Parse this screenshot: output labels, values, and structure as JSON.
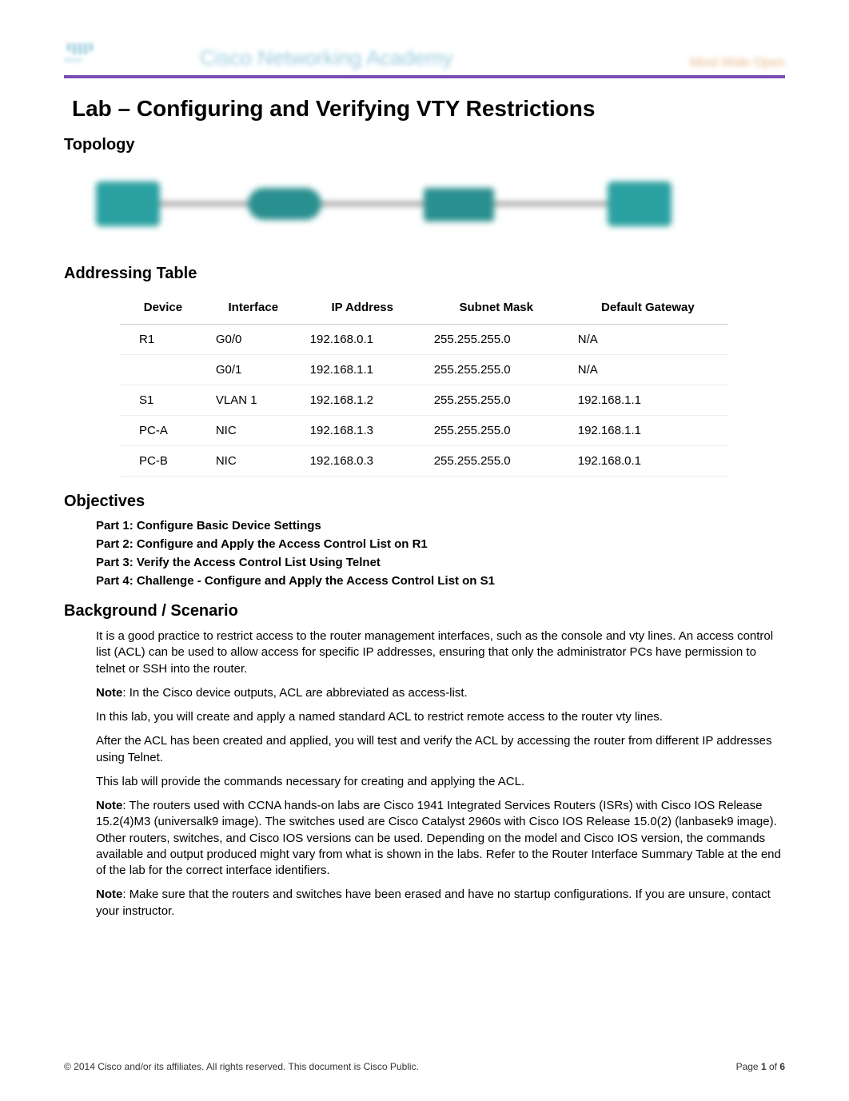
{
  "header": {
    "logo_word": "cisco",
    "academy": "Cisco Networking Academy",
    "tagline": "Mind Wide Open"
  },
  "title": "Lab – Configuring and Verifying VTY Restrictions",
  "sections": {
    "topology": "Topology",
    "addressing": "Addressing Table",
    "objectives": "Objectives",
    "background": "Background / Scenario"
  },
  "addressing_table": {
    "headers": [
      "Device",
      "Interface",
      "IP Address",
      "Subnet Mask",
      "Default Gateway"
    ],
    "rows": [
      [
        "R1",
        "G0/0",
        "192.168.0.1",
        "255.255.255.0",
        "N/A"
      ],
      [
        "",
        "G0/1",
        "192.168.1.1",
        "255.255.255.0",
        "N/A"
      ],
      [
        "S1",
        "VLAN 1",
        "192.168.1.2",
        "255.255.255.0",
        "192.168.1.1"
      ],
      [
        "PC-A",
        "NIC",
        "192.168.1.3",
        "255.255.255.0",
        "192.168.1.1"
      ],
      [
        "PC-B",
        "NIC",
        "192.168.0.3",
        "255.255.255.0",
        "192.168.0.1"
      ]
    ]
  },
  "objectives": [
    "Part 1: Configure Basic Device Settings",
    "Part 2: Configure and Apply the Access Control List on R1",
    "Part 3: Verify the Access Control List Using Telnet",
    "Part 4: Challenge - Configure and Apply the Access Control List on S1"
  ],
  "background_paras": [
    "It is a good practice to restrict access to the router management interfaces, such as the console and vty lines. An access control list (ACL) can be used to allow access for specific IP addresses, ensuring that only the administrator PCs have permission to telnet or SSH into the router.",
    "Note: In the Cisco device outputs, ACL are abbreviated as access-list.",
    "In this lab, you will create and apply a named standard ACL to restrict remote access to the router vty lines.",
    "After the ACL has been created and applied, you will test and verify the ACL by accessing the router from different IP addresses using Telnet.",
    "This lab will provide the commands necessary for creating and applying the ACL.",
    "Note: The routers used with CCNA hands-on labs are Cisco 1941 Integrated Services Routers (ISRs) with Cisco IOS Release 15.2(4)M3 (universalk9 image). The switches used are Cisco Catalyst 2960s with Cisco IOS Release 15.0(2) (lanbasek9 image). Other routers, switches, and Cisco IOS versions can be used. Depending on the model and Cisco IOS version, the commands available and output produced might vary from what is shown in the labs. Refer to the Router Interface Summary Table at the end of the lab for the correct interface identifiers.",
    "Note: Make sure that the routers and switches have been erased and have no startup configurations. If you are unsure, contact your instructor."
  ],
  "footer": {
    "left": "© 2014 Cisco and/or its affiliates. All rights reserved. This document is Cisco Public.",
    "right_prefix": "Page ",
    "page_current": "1",
    "right_mid": " of ",
    "page_total": "6"
  }
}
